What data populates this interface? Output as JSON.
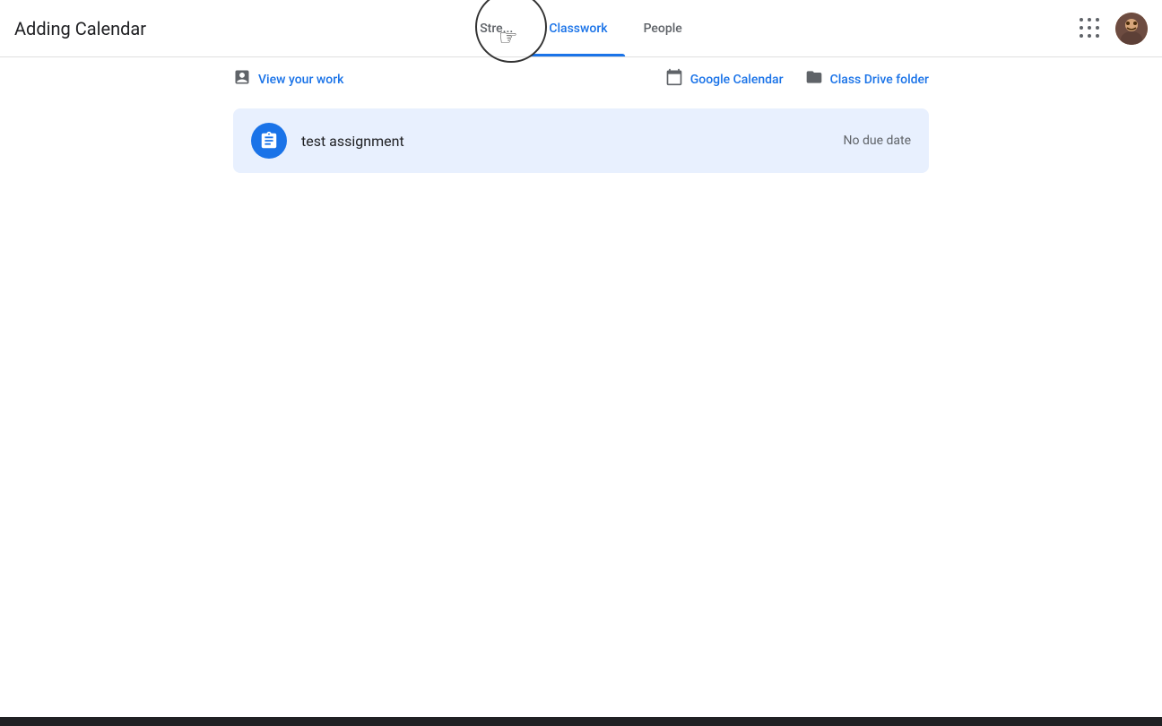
{
  "header": {
    "app_title": "Adding Calendar",
    "tabs": [
      {
        "id": "stream",
        "label": "Stre..."
      },
      {
        "id": "classwork",
        "label": "Classwork",
        "active": true
      },
      {
        "id": "people",
        "label": "People"
      }
    ],
    "apps_icon_label": "Google apps",
    "avatar_alt": "User avatar"
  },
  "toolbar": {
    "view_your_work_label": "View your work",
    "google_calendar_label": "Google Calendar",
    "class_drive_folder_label": "Class Drive folder"
  },
  "assignments": [
    {
      "title": "test assignment",
      "due": "No due date"
    }
  ],
  "colors": {
    "primary_blue": "#1a73e8",
    "active_tab_underline": "#1a73e8",
    "assignment_bg": "#e8f0fe"
  }
}
